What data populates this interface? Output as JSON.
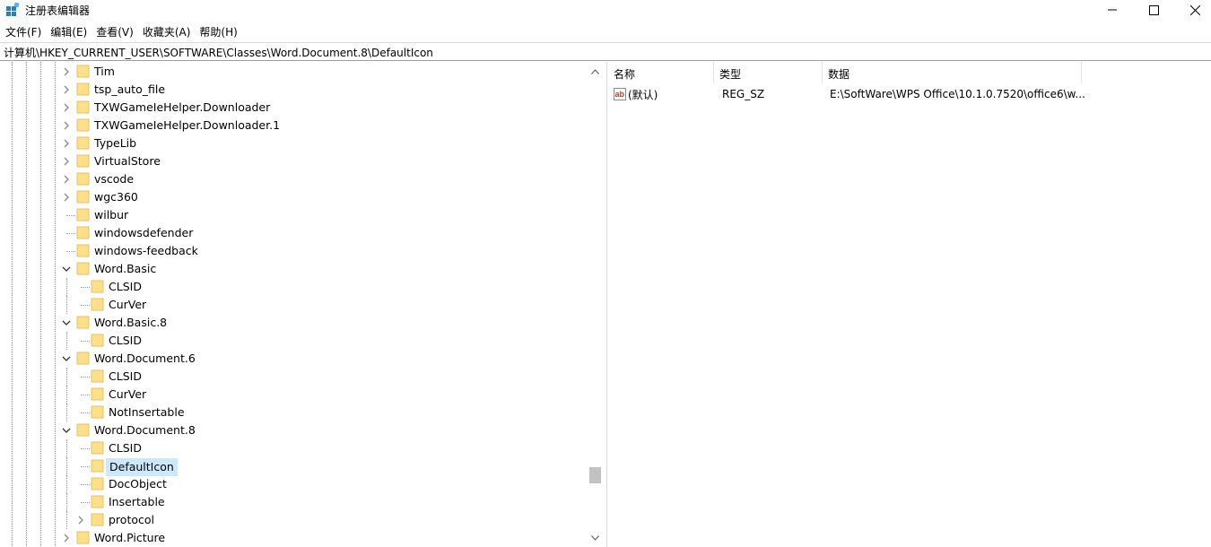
{
  "window": {
    "title": "注册表编辑器"
  },
  "menu": [
    {
      "label": "文件(F)"
    },
    {
      "label": "编辑(E)"
    },
    {
      "label": "查看(V)"
    },
    {
      "label": "收藏夹(A)"
    },
    {
      "label": "帮助(H)"
    }
  ],
  "address": {
    "path": "计算机\\HKEY_CURRENT_USER\\SOFTWARE\\Classes\\Word.Document.8\\DefaultIcon"
  },
  "tree": {
    "items": [
      {
        "label": "Tim",
        "level": 0,
        "expander": "collapsed"
      },
      {
        "label": "tsp_auto_file",
        "level": 0,
        "expander": "collapsed"
      },
      {
        "label": "TXWGameIeHelper.Downloader",
        "level": 0,
        "expander": "collapsed"
      },
      {
        "label": "TXWGameIeHelper.Downloader.1",
        "level": 0,
        "expander": "collapsed"
      },
      {
        "label": "TypeLib",
        "level": 0,
        "expander": "collapsed"
      },
      {
        "label": "VirtualStore",
        "level": 0,
        "expander": "collapsed"
      },
      {
        "label": "vscode",
        "level": 0,
        "expander": "collapsed"
      },
      {
        "label": "wgc360",
        "level": 0,
        "expander": "collapsed"
      },
      {
        "label": "wilbur",
        "level": 0,
        "expander": "none"
      },
      {
        "label": "windowsdefender",
        "level": 0,
        "expander": "none"
      },
      {
        "label": "windows-feedback",
        "level": 0,
        "expander": "none"
      },
      {
        "label": "Word.Basic",
        "level": 0,
        "expander": "expanded"
      },
      {
        "label": "CLSID",
        "level": 1,
        "expander": "none"
      },
      {
        "label": "CurVer",
        "level": 1,
        "expander": "none"
      },
      {
        "label": "Word.Basic.8",
        "level": 0,
        "expander": "expanded"
      },
      {
        "label": "CLSID",
        "level": 1,
        "expander": "none"
      },
      {
        "label": "Word.Document.6",
        "level": 0,
        "expander": "expanded"
      },
      {
        "label": "CLSID",
        "level": 1,
        "expander": "none"
      },
      {
        "label": "CurVer",
        "level": 1,
        "expander": "none"
      },
      {
        "label": "NotInsertable",
        "level": 1,
        "expander": "none"
      },
      {
        "label": "Word.Document.8",
        "level": 0,
        "expander": "expanded"
      },
      {
        "label": "CLSID",
        "level": 1,
        "expander": "none"
      },
      {
        "label": "DefaultIcon",
        "level": 1,
        "expander": "none",
        "selected": true
      },
      {
        "label": "DocObject",
        "level": 1,
        "expander": "none"
      },
      {
        "label": "Insertable",
        "level": 1,
        "expander": "none"
      },
      {
        "label": "protocol",
        "level": 1,
        "expander": "collapsed"
      },
      {
        "label": "Word.Picture",
        "level": 0,
        "expander": "collapsed"
      }
    ]
  },
  "list": {
    "columns": [
      {
        "label": "名称"
      },
      {
        "label": "类型"
      },
      {
        "label": "数据"
      }
    ],
    "rows": [
      {
        "name": "(默认)",
        "type": "REG_SZ",
        "data": "E:\\SoftWare\\WPS Office\\10.1.0.7520\\office6\\w..."
      }
    ]
  },
  "colors": {
    "selection": "#cce8ff",
    "folder": "#ffe08a",
    "folder_edge": "#e0b84a",
    "scroll_thumb": "#c2c2c2"
  }
}
